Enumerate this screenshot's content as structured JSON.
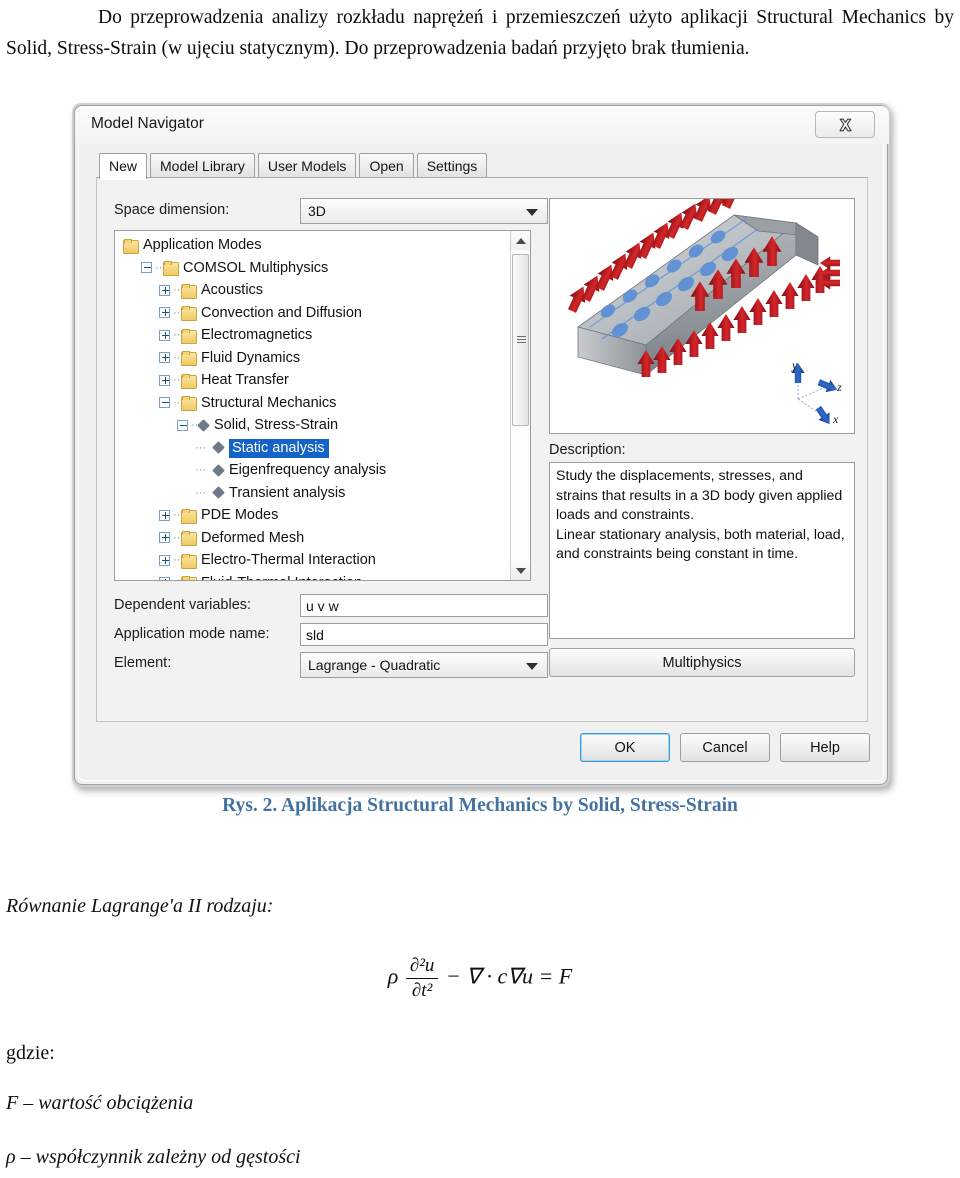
{
  "document": {
    "intro_paragraph": "Do przeprowadzenia analizy rozkładu naprężeń i przemieszczeń użyto aplikacji Structural Mechanics by Solid, Stress-Strain (w ujęciu statycznym). Do przeprowadzenia badań przyjęto brak tłumienia.",
    "figure_caption": "Rys. 2. Aplikacja Structural Mechanics by Solid, Stress-Strain",
    "equation_intro": "Równanie Lagrange'a II rodzaju:",
    "where_label": "gdzie:",
    "definition_F": "F – wartość obciążenia",
    "definition_rho": "ρ – współczynnik zależny od gęstości",
    "equation": {
      "rho": "ρ",
      "numerator": "∂²u",
      "denominator": "∂t²",
      "rest": "− ∇ · c∇u = F"
    },
    "caption_color": "#4472a0"
  },
  "dialog": {
    "title": "Model Navigator",
    "close_icon": "close-icon",
    "tabs": [
      {
        "label": "New",
        "active": true
      },
      {
        "label": "Model Library",
        "active": false
      },
      {
        "label": "User Models",
        "active": false
      },
      {
        "label": "Open",
        "active": false
      },
      {
        "label": "Settings",
        "active": false
      }
    ],
    "space_dimension": {
      "label": "Space dimension:",
      "value": "3D"
    },
    "tree": [
      {
        "label": "Application Modes",
        "depth": 0,
        "icon": "folder",
        "expander": "none",
        "selected": false
      },
      {
        "label": "COMSOL Multiphysics",
        "depth": 1,
        "icon": "folder",
        "expander": "minus",
        "selected": false
      },
      {
        "label": "Acoustics",
        "depth": 2,
        "icon": "folder",
        "expander": "plus",
        "selected": false
      },
      {
        "label": "Convection and Diffusion",
        "depth": 2,
        "icon": "folder",
        "expander": "plus",
        "selected": false
      },
      {
        "label": "Electromagnetics",
        "depth": 2,
        "icon": "folder",
        "expander": "plus",
        "selected": false
      },
      {
        "label": "Fluid Dynamics",
        "depth": 2,
        "icon": "folder",
        "expander": "plus",
        "selected": false
      },
      {
        "label": "Heat Transfer",
        "depth": 2,
        "icon": "folder",
        "expander": "plus",
        "selected": false
      },
      {
        "label": "Structural Mechanics",
        "depth": 2,
        "icon": "folder",
        "expander": "minus",
        "selected": false
      },
      {
        "label": "Solid, Stress-Strain",
        "depth": 3,
        "icon": "node",
        "expander": "minus",
        "selected": false
      },
      {
        "label": "Static analysis",
        "depth": 4,
        "icon": "node",
        "expander": "leaf",
        "selected": true
      },
      {
        "label": "Eigenfrequency analysis",
        "depth": 4,
        "icon": "node",
        "expander": "leaf",
        "selected": false
      },
      {
        "label": "Transient analysis",
        "depth": 4,
        "icon": "node",
        "expander": "leaf",
        "selected": false
      },
      {
        "label": "PDE Modes",
        "depth": 2,
        "icon": "folder",
        "expander": "plus",
        "selected": false
      },
      {
        "label": "Deformed Mesh",
        "depth": 2,
        "icon": "folder",
        "expander": "plus",
        "selected": false
      },
      {
        "label": "Electro-Thermal Interaction",
        "depth": 2,
        "icon": "folder",
        "expander": "plus",
        "selected": false
      },
      {
        "label": "Fluid-Thermal Interaction",
        "depth": 2,
        "icon": "folder",
        "expander": "plus",
        "selected": false
      }
    ],
    "selection_color": "#1463c8",
    "fields": {
      "dependent_variables_label": "Dependent variables:",
      "dependent_variables_value": "u v w",
      "application_mode_name_label": "Application mode name:",
      "application_mode_name_value": "sld",
      "element_label": "Element:",
      "element_value": "Lagrange - Quadratic"
    },
    "description": {
      "label": "Description:",
      "text": "Study the displacements, stresses, and strains that results in a 3D body given applied loads and constraints.\nLinear stationary analysis, both material, load, and constraints being constant in time."
    },
    "multiphysics_button": "Multiphysics",
    "footer": {
      "ok": "OK",
      "cancel": "Cancel",
      "help": "Help"
    },
    "preview": {
      "axis_labels": {
        "x": "x",
        "y": "y",
        "z": "z"
      },
      "arrow_color": "#c0191c",
      "axis_color": "#1f4fa8",
      "body_color": "#b9bdc2"
    }
  }
}
